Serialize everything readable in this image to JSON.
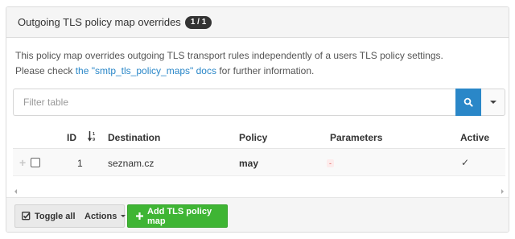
{
  "header": {
    "title": "Outgoing TLS policy map overrides",
    "badge": "1 / 1"
  },
  "description": {
    "line1": "This policy map overrides outgoing TLS transport rules independently of a users TLS policy settings.",
    "line2_prefix": "Please check ",
    "link": "the \"smtp_tls_policy_maps\" docs",
    "line2_suffix": " for further information."
  },
  "filter": {
    "placeholder": "Filter table"
  },
  "table": {
    "columns": [
      "ID",
      "Destination",
      "Policy",
      "Parameters",
      "Active"
    ],
    "rows": [
      {
        "id": "1",
        "destination": "seznam.cz",
        "policy": "may",
        "parameters": "-",
        "active": "✓"
      }
    ]
  },
  "footer": {
    "toggle_all": "Toggle all",
    "actions": "Actions",
    "add": "Add TLS policy map"
  },
  "colors": {
    "primary": "#2a87c8",
    "success": "#3fb534",
    "danger": "#d9534f"
  },
  "icons": [
    "search-icon",
    "caret-down-icon",
    "sort-icon",
    "expand-plus-icon",
    "checkbox-icon",
    "plus-icon"
  ]
}
